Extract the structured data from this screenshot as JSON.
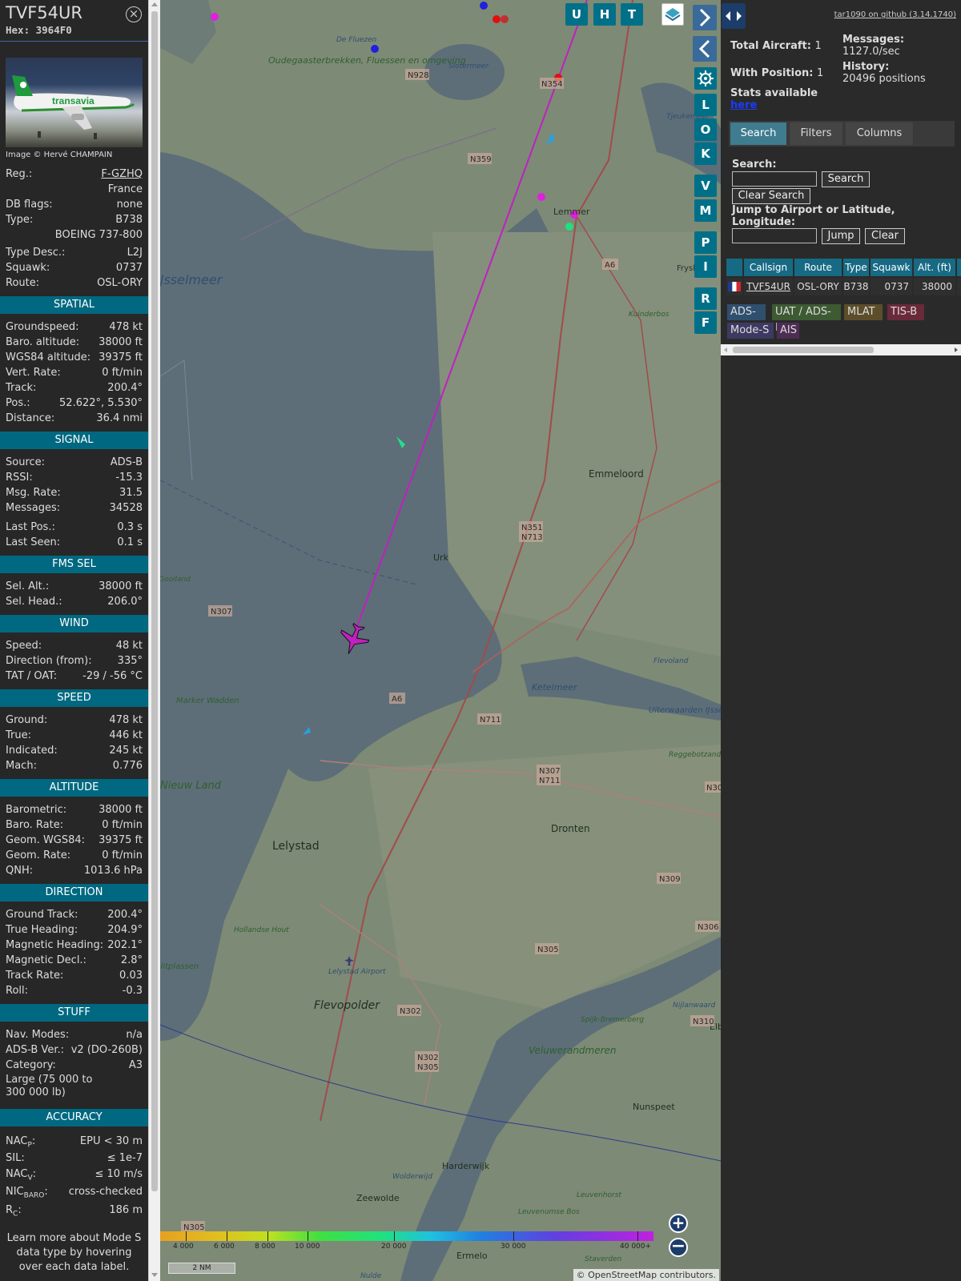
{
  "header": {
    "callsign": "TVF54UR",
    "hex": "Hex: 3964F0"
  },
  "photo": {
    "credit": "Image © Hervé CHAMPAIN",
    "livery_text": "transavia"
  },
  "info": [
    {
      "k": "Reg.:",
      "v": "F-GZHQ"
    },
    {
      "k": "",
      "v": "France"
    },
    {
      "k": "DB flags:",
      "v": "none"
    },
    {
      "k": "Type:",
      "v": "B738"
    },
    {
      "k": "",
      "v": "BOEING 737-800"
    },
    {
      "k": "Type Desc.:",
      "v": "L2J"
    },
    {
      "k": "Squawk:",
      "v": "0737"
    },
    {
      "k": "Route:",
      "v": "OSL-ORY"
    }
  ],
  "sections": [
    {
      "title": "SPATIAL",
      "rows": [
        {
          "k": "Groundspeed:",
          "v": "478 kt"
        },
        {
          "k": "Baro. altitude:",
          "v": "38000 ft"
        },
        {
          "k": "WGS84 altitude:",
          "v": "39375 ft"
        },
        {
          "k": "Vert. Rate:",
          "v": "0 ft/min"
        },
        {
          "k": "Track:",
          "v": "200.4°"
        },
        {
          "k": "Pos.:",
          "v": "52.622°, 5.530°"
        },
        {
          "k": "Distance:",
          "v": "36.4 nmi"
        }
      ]
    },
    {
      "title": "SIGNAL",
      "rows": [
        {
          "k": "Source:",
          "v": "ADS-B"
        },
        {
          "k": "RSSI:",
          "v": "-15.3"
        },
        {
          "k": "Msg. Rate:",
          "v": "31.5"
        },
        {
          "k": "Messages:",
          "v": "34528"
        },
        {
          "k": "Last Pos.:",
          "v": "0.3 s"
        },
        {
          "k": "Last Seen:",
          "v": "0.1 s"
        }
      ]
    },
    {
      "title": "FMS SEL",
      "rows": [
        {
          "k": "Sel. Alt.:",
          "v": "38000 ft"
        },
        {
          "k": "Sel. Head.:",
          "v": "206.0°"
        }
      ]
    },
    {
      "title": "WIND",
      "rows": [
        {
          "k": "Speed:",
          "v": "48 kt"
        },
        {
          "k": "Direction (from):",
          "v": "335°"
        },
        {
          "k": "TAT / OAT:",
          "v": "-29 / -56 °C"
        }
      ]
    },
    {
      "title": "SPEED",
      "rows": [
        {
          "k": "Ground:",
          "v": "478 kt"
        },
        {
          "k": "True:",
          "v": "446 kt"
        },
        {
          "k": "Indicated:",
          "v": "245 kt"
        },
        {
          "k": "Mach:",
          "v": "0.776"
        }
      ]
    },
    {
      "title": "ALTITUDE",
      "rows": [
        {
          "k": "Barometric:",
          "v": "38000 ft"
        },
        {
          "k": "Baro. Rate:",
          "v": "0 ft/min"
        },
        {
          "k": "Geom. WGS84:",
          "v": "39375 ft"
        },
        {
          "k": "Geom. Rate:",
          "v": "0 ft/min"
        },
        {
          "k": "QNH:",
          "v": "1013.6 hPa"
        }
      ]
    },
    {
      "title": "DIRECTION",
      "rows": [
        {
          "k": "Ground Track:",
          "v": "200.4°"
        },
        {
          "k": "True Heading:",
          "v": "204.9°"
        },
        {
          "k": "Magnetic Heading:",
          "v": "202.1°"
        },
        {
          "k": "Magnetic Decl.:",
          "v": "2.8°"
        },
        {
          "k": "Track Rate:",
          "v": "0.03"
        },
        {
          "k": "Roll:",
          "v": "-0.3"
        }
      ]
    },
    {
      "title": "STUFF",
      "rows": [
        {
          "k": "Nav. Modes:",
          "v": "n/a"
        },
        {
          "k": "ADS-B Ver.:",
          "v": "v2 (DO-260B)"
        },
        {
          "k": "Category:",
          "v": "A3"
        }
      ]
    }
  ],
  "category_desc": "Large (75 000 to 300 000 lb)",
  "accuracy": {
    "title": "ACCURACY",
    "nacp_k": "NAC",
    "nacp_sub": "P",
    "nacp_v": "EPU < 30 m",
    "sil_k": "SIL:",
    "sil_v": "≤ 1e-7",
    "nacv_k": "NAC",
    "nacv_sub": "V",
    "nacv_v": "≤ 10 m/s",
    "nic_k": "NIC",
    "nic_sub": "BARO",
    "nic_v": "cross-checked",
    "rc_k": "R",
    "rc_sub": "C",
    "rc_v": "186 m"
  },
  "footer_note": "Learn more about Mode S data type by hovering over each data label.",
  "map": {
    "top_buttons": [
      "U",
      "H",
      "T"
    ],
    "side_buttons": [
      "L",
      "O",
      "K",
      "V",
      "M",
      "P",
      "I",
      "R",
      "F"
    ],
    "place_labels": [
      {
        "t": "Oudegaasterbrekken, Fluessen en omgeving"
      },
      {
        "t": "De Fluezen"
      },
      {
        "t": "Slotermeer"
      },
      {
        "t": "IJsselmeer"
      },
      {
        "t": "Lemmer"
      },
      {
        "t": "Emmeloord"
      },
      {
        "t": "Urk"
      },
      {
        "t": "Ketelmeer"
      },
      {
        "t": "Marker Wadden"
      },
      {
        "t": "Nieuw Land"
      },
      {
        "t": "Lelystad"
      },
      {
        "t": "Dronten"
      },
      {
        "t": "Flevopolder"
      },
      {
        "t": "Lelystad Airport"
      },
      {
        "t": "Hollandse Hout"
      },
      {
        "t": "Veluwerandmeren"
      },
      {
        "t": "Spijk-Bremerberg"
      },
      {
        "t": "Harderwijk"
      },
      {
        "t": "Zeewolde"
      },
      {
        "t": "Nunspeet"
      },
      {
        "t": "Ermelo"
      },
      {
        "t": "Flevoland"
      },
      {
        "t": "Uiterwaarden IJssel"
      },
      {
        "t": "Reggebotzand"
      },
      {
        "t": "Kuinderbos"
      },
      {
        "t": "Leuvenhorst"
      },
      {
        "t": "Leuvenumse Bos"
      },
      {
        "t": "Staverden"
      },
      {
        "t": "Wolderwijd"
      },
      {
        "t": "Tjeukemeer"
      },
      {
        "t": "Frysl"
      },
      {
        "t": "Nulde"
      },
      {
        "t": "Elb"
      },
      {
        "t": "Gooiland"
      },
      {
        "t": "Nijlanwaard"
      },
      {
        "t": "Uitplassen"
      }
    ],
    "road_labels": [
      "N928",
      "N354",
      "N359",
      "A6",
      "N351",
      "N713",
      "N307",
      "N711",
      "N307",
      "N711",
      "N309",
      "N305",
      "N302",
      "N302",
      "N305",
      "N306",
      "N310",
      "N305",
      "A6",
      "N30"
    ],
    "scale_ticks": [
      "4 000",
      "6 000",
      "8 000",
      "10 000",
      "20 000",
      "30 000",
      "40 000+"
    ],
    "scale_bar": "2 NM",
    "attribution": "© OpenStreetMap contributors."
  },
  "panel": {
    "github": "tar1090 on github (3.14.1740)",
    "total_label": "Total Aircraft:",
    "total_val": "1",
    "pos_label": "With Position:",
    "pos_val": "1",
    "stats": "Stats available",
    "here": "here",
    "messages_label": "Messages:",
    "messages_val": "1127.0/sec",
    "history_label": "History:",
    "history_val": "20496 positions",
    "tabs": [
      "Search",
      "Filters",
      "Columns"
    ],
    "search_label": "Search:",
    "search_btn": "Search",
    "clear_search_btn": "Clear Search",
    "jump_label": "Jump to Airport or Latitude, Longitude:",
    "jump_btn": "Jump",
    "clear_btn": "Clear",
    "columns": [
      "Callsign",
      "Route",
      "Type",
      "Squawk",
      "Alt. (ft)"
    ],
    "row": {
      "callsign": "TVF54UR",
      "route": "OSL-ORY",
      "type": "B738",
      "squawk": "0737",
      "alt": "38000"
    },
    "chips": [
      {
        "label": "ADS-B",
        "color": "#2f4f6f"
      },
      {
        "label": "UAT / ADS-R",
        "color": "#3d5a33"
      },
      {
        "label": "MLAT",
        "color": "#5c4e2a"
      },
      {
        "label": "TIS-B",
        "color": "#6a2a3a"
      },
      {
        "label": "Mode-S",
        "color": "#3c3a63"
      },
      {
        "label": "AIS",
        "color": "#4e2d55"
      }
    ]
  }
}
